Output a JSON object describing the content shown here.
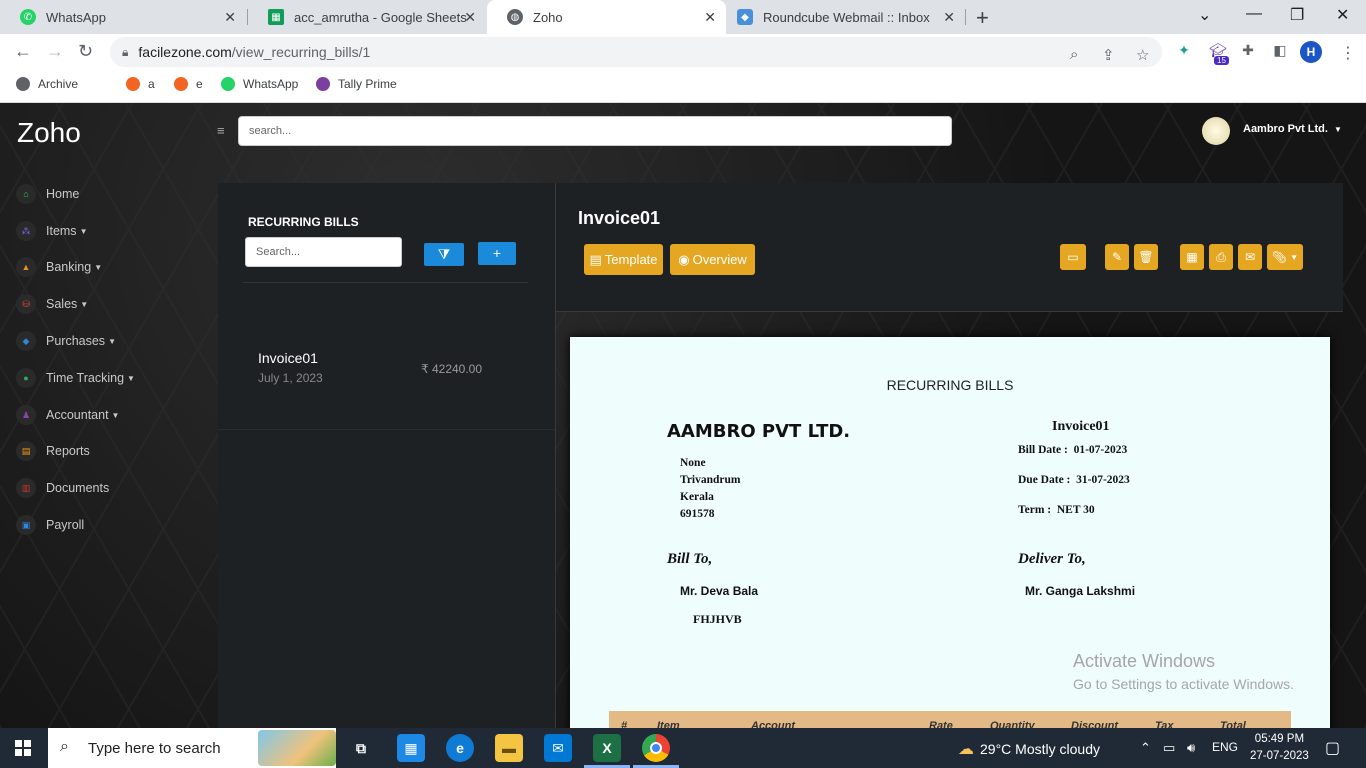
{
  "browser": {
    "tabs": [
      {
        "title": "WhatsApp",
        "color": "#25d366"
      },
      {
        "title": "acc_amrutha - Google Sheets",
        "color": "#0f9d58"
      },
      {
        "title": "Zoho",
        "color": "#5f6368"
      },
      {
        "title": "Roundcube Webmail :: Inbox",
        "color": "#4a90d9"
      }
    ],
    "url_host": "facilezone.com",
    "url_path": "/view_recurring_bills/1",
    "profile_initial": "H",
    "ext_badge": "15",
    "bookmarks": [
      "Archive",
      "a",
      "e",
      "WhatsApp",
      "Tally Prime"
    ]
  },
  "app": {
    "logo": "Zoho",
    "search_placeholder": "search...",
    "company": "Aambro Pvt Ltd.",
    "nav": [
      {
        "label": "Home",
        "dropdown": false,
        "color": "#3fbf5f"
      },
      {
        "label": "Items",
        "dropdown": true,
        "color": "#7b68ee"
      },
      {
        "label": "Banking",
        "dropdown": true,
        "color": "#e58e26"
      },
      {
        "label": "Sales",
        "dropdown": true,
        "color": "#e74c3c"
      },
      {
        "label": "Purchases",
        "dropdown": true,
        "color": "#2e86de"
      },
      {
        "label": "Time Tracking",
        "dropdown": true,
        "color": "#27ae60"
      },
      {
        "label": "Accountant",
        "dropdown": true,
        "color": "#8e44ad"
      },
      {
        "label": "Reports",
        "dropdown": false,
        "color": "#f39c12"
      },
      {
        "label": "Documents",
        "dropdown": false,
        "color": "#c0392b"
      },
      {
        "label": "Payroll",
        "dropdown": false,
        "color": "#2e86de"
      }
    ]
  },
  "list": {
    "title": "RECURRING BILLS",
    "search_placeholder": "Search...",
    "items": [
      {
        "name": "Invoice01",
        "date": "July 1, 2023",
        "amount": "₹ 42240.00"
      }
    ]
  },
  "detail": {
    "title": "Invoice01",
    "template_label": "Template",
    "overview_label": "Overview"
  },
  "document": {
    "heading": "RECURRING BILLS",
    "company": "AAMBRO PVT LTD.",
    "address": [
      "None",
      "Trivandrum",
      "Kerala",
      "691578"
    ],
    "invoice_no": "Invoice01",
    "bill_date_label": "Bill Date :",
    "bill_date": "01-07-2023",
    "due_date_label": "Due Date :",
    "due_date": "31-07-2023",
    "term_label": "Term :",
    "term": "NET 30",
    "bill_to_label": "Bill To,",
    "bill_to_name": "Mr. Deva Bala",
    "bill_to_extra": "FHJHVB",
    "deliver_to_label": "Deliver To,",
    "deliver_to_name": "Mr. Ganga Lakshmi",
    "table_headers": [
      "#",
      "Item",
      "Account",
      "Rate",
      "Quantity",
      "Discount",
      "Tax",
      "Total"
    ]
  },
  "watermark": {
    "line1": "Activate Windows",
    "line2": "Go to Settings to activate Windows."
  },
  "taskbar": {
    "search_placeholder": "Type here to search",
    "weather": "29°C  Mostly cloudy",
    "lang": "ENG",
    "time": "05:49 PM",
    "date": "27-07-2023"
  }
}
